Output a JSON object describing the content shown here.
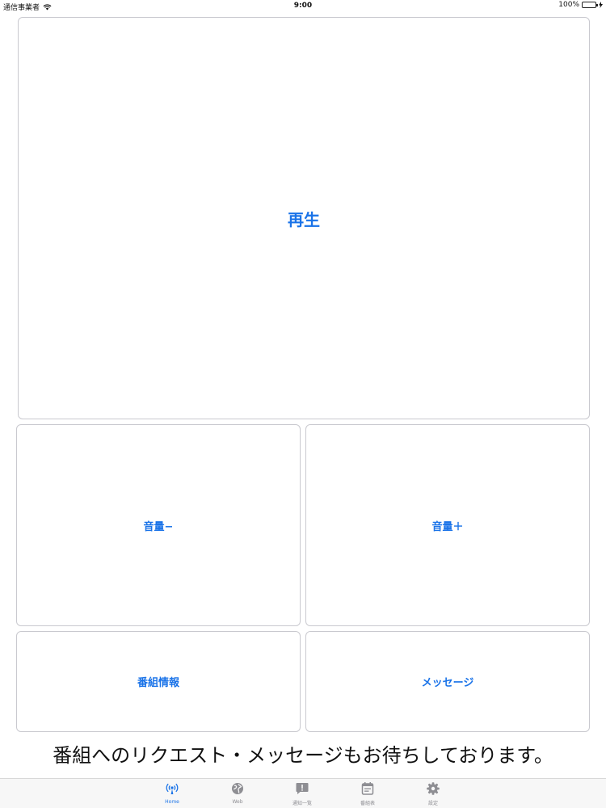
{
  "status_bar": {
    "carrier": "通信事業者",
    "time": "9:00",
    "battery": "100%"
  },
  "main": {
    "play_label": "再生",
    "volume_down_label": "音量−",
    "volume_up_label": "音量＋",
    "program_info_label": "番組情報",
    "message_label": "メッセージ"
  },
  "notice": "番組へのリクエスト・メッセージもお待ちしております。",
  "tab_bar": {
    "active_color": "#1a73e8",
    "inactive_color": "#8e8e93",
    "tabs": [
      {
        "label": "Home",
        "icon": "broadcast-icon",
        "active": true
      },
      {
        "label": "Web",
        "icon": "globe-icon",
        "active": false
      },
      {
        "label": "通知一覧",
        "icon": "message-alert-icon",
        "active": false
      },
      {
        "label": "番組表",
        "icon": "calendar-icon",
        "active": false
      },
      {
        "label": "設定",
        "icon": "gear-icon",
        "active": false
      }
    ]
  }
}
